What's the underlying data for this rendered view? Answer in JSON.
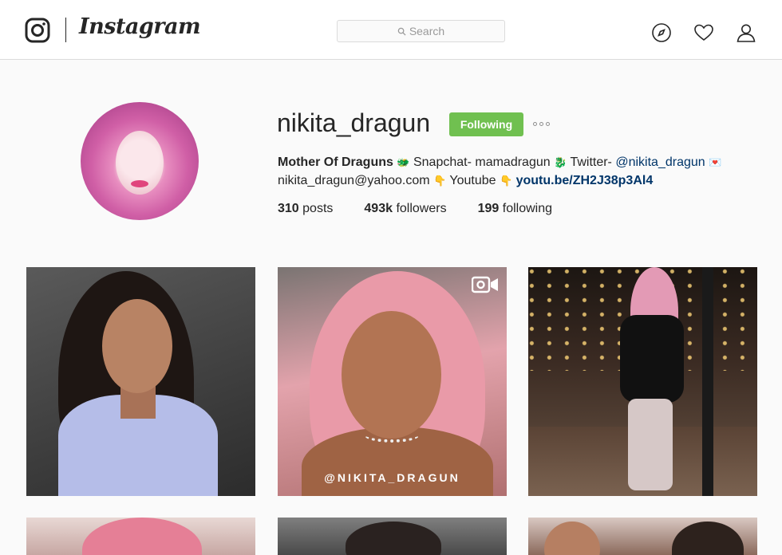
{
  "header": {
    "brand": "Instagram",
    "search_placeholder": "Search",
    "nav_icons": [
      "compass-icon",
      "heart-icon",
      "person-icon"
    ]
  },
  "profile": {
    "username": "nikita_dragun",
    "follow_label": "Following",
    "bio": {
      "name": "Mother Of Draguns",
      "snapchat_text": "Snapchat- mamadragun",
      "twitter_prefix": "Twitter-",
      "twitter_handle": "@nikita_dragun",
      "email": "nikita_dragun@yahoo.com",
      "youtube_label": "Youtube",
      "youtube_link": "youtu.be/ZH2J38p3Al4"
    },
    "stats": {
      "posts_count": "310",
      "posts_label": "posts",
      "followers_count": "493k",
      "followers_label": "followers",
      "following_count": "199",
      "following_label": "following"
    }
  },
  "grid": {
    "video_watermark": "@NIKITA_DRAGUN"
  },
  "colors": {
    "follow_button": "#70c050",
    "link": "#003569",
    "background": "#fafafa"
  }
}
